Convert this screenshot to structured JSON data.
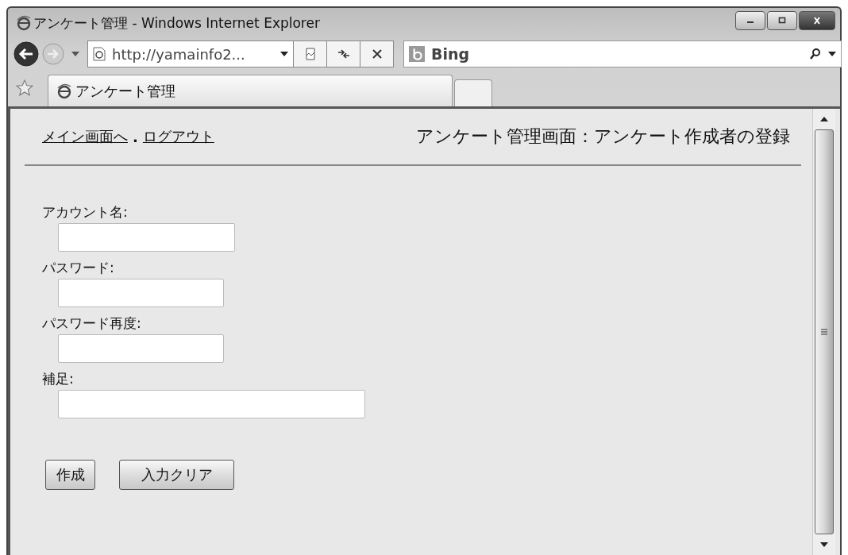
{
  "window": {
    "title": "アンケート管理 - Windows Internet Explorer"
  },
  "address_bar": {
    "value": "http://yamainfo2..."
  },
  "search_box": {
    "value": "Bing"
  },
  "tabs": [
    {
      "label": "アンケート管理",
      "selected": true
    }
  ],
  "page": {
    "links": [
      "メイン画面へ",
      "ログアウト"
    ],
    "link_separator": ".",
    "heading": "アンケート管理画面：アンケート作成者の登録",
    "fields": [
      {
        "label": "アカウント名:",
        "kind": "text"
      },
      {
        "label": "パスワード:",
        "kind": "text"
      },
      {
        "label": "パスワード再度:",
        "kind": "text"
      },
      {
        "label": "補足:",
        "kind": "wide"
      }
    ],
    "buttons": [
      "作成",
      "入力クリア"
    ]
  }
}
